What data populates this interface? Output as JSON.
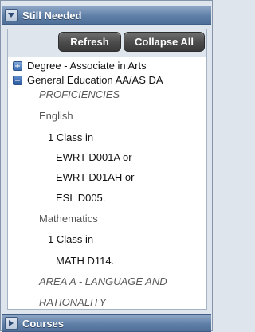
{
  "still_needed_panel": {
    "title": "Still Needed",
    "buttons": {
      "refresh": "Refresh",
      "collapse_all": "Collapse All"
    },
    "tree": [
      {
        "label": "Degree - Associate in Arts",
        "icon": "plus-square-icon"
      },
      {
        "label": "General Education AA/AS DA",
        "icon": "minus-square-icon"
      }
    ],
    "details": {
      "cat1": "PROFICIENCIES",
      "sub1": "English",
      "req1": "1 Class in",
      "c1": "EWRT D001A or",
      "c2": "EWRT D01AH or",
      "c3": "ESL D005.",
      "sub2": "Mathematics",
      "req2": "1 Class in",
      "c4": "MATH D114.",
      "cat2a": "AREA A - LANGUAGE AND",
      "cat2b": "RATIONALITY"
    }
  },
  "courses_panel": {
    "title": "Courses"
  }
}
